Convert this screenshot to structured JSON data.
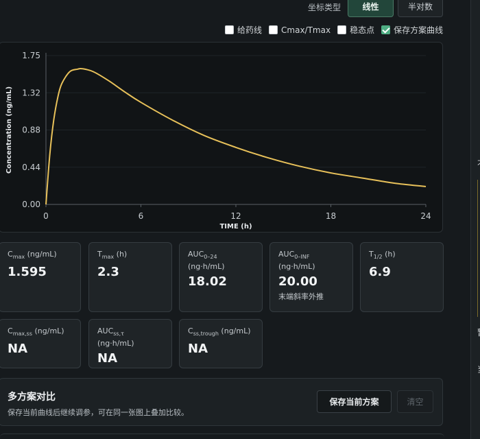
{
  "toolbar": {
    "scale_label": "坐标类型",
    "linear_label": "线性",
    "log_label": "半对数"
  },
  "options": [
    {
      "label": "给药线",
      "checked": false
    },
    {
      "label": "Cmax/Tmax",
      "checked": false
    },
    {
      "label": "稳态点",
      "checked": false
    },
    {
      "label": "保存方案曲线",
      "checked": true
    }
  ],
  "chart_data": {
    "type": "line",
    "xlabel": "TIME (h)",
    "ylabel": "Concentration (ng/mL)",
    "xlim": [
      0,
      24
    ],
    "ylim": [
      0,
      1.75
    ],
    "xticks": [
      "0",
      "6",
      "12",
      "18",
      "24"
    ],
    "yticks": [
      "0.00",
      "0.44",
      "0.88",
      "1.32",
      "1.75"
    ],
    "grid": true,
    "series": [
      {
        "color": "#e8c15a",
        "x": [
          0,
          0.25,
          0.5,
          0.75,
          1,
          1.5,
          2,
          2.3,
          3,
          4,
          5,
          6,
          8,
          10,
          12,
          14,
          16,
          18,
          20,
          22,
          24
        ],
        "y": [
          0,
          0.6,
          1.0,
          1.26,
          1.42,
          1.56,
          1.59,
          1.595,
          1.56,
          1.45,
          1.32,
          1.2,
          0.99,
          0.81,
          0.67,
          0.55,
          0.45,
          0.37,
          0.31,
          0.25,
          0.21
        ]
      }
    ]
  },
  "stats": [
    {
      "name": "C",
      "sub": "max",
      "unit": " (ng/mL)",
      "value": "1.595",
      "note": ""
    },
    {
      "name": "T",
      "sub": "max",
      "unit": " (h)",
      "value": "2.3",
      "note": ""
    },
    {
      "name": "AUC",
      "sub": "0–24",
      "unit": " (ng·h/mL)",
      "value": "18.02",
      "note": ""
    },
    {
      "name": "AUC",
      "sub": "0–INF",
      "unit": "(ng·h/mL)",
      "value": "20.00",
      "note": "末端斜率外推"
    },
    {
      "name": "T",
      "sub": "1/2",
      "unit": " (h)",
      "value": "6.9",
      "note": ""
    },
    {
      "name": "C",
      "sub": "max,ss",
      "unit": " (ng/mL)",
      "value": "NA",
      "note": ""
    },
    {
      "name": "AUC",
      "sub": "ss,τ",
      "unit": " (ng·h/mL)",
      "value": "NA",
      "note": ""
    },
    {
      "name": "C",
      "sub": "ss,trough",
      "unit": " (ng/mL)",
      "value": "NA",
      "note": ""
    }
  ],
  "compare": {
    "title": "多方案对比",
    "desc": "保存当前曲线后继续调参，可在同一张图上叠加比较。",
    "save_label": "保存当前方案",
    "clear_label": "清空"
  },
  "side": {
    "char1": "不",
    "char2": "暂",
    "char3": "当"
  }
}
